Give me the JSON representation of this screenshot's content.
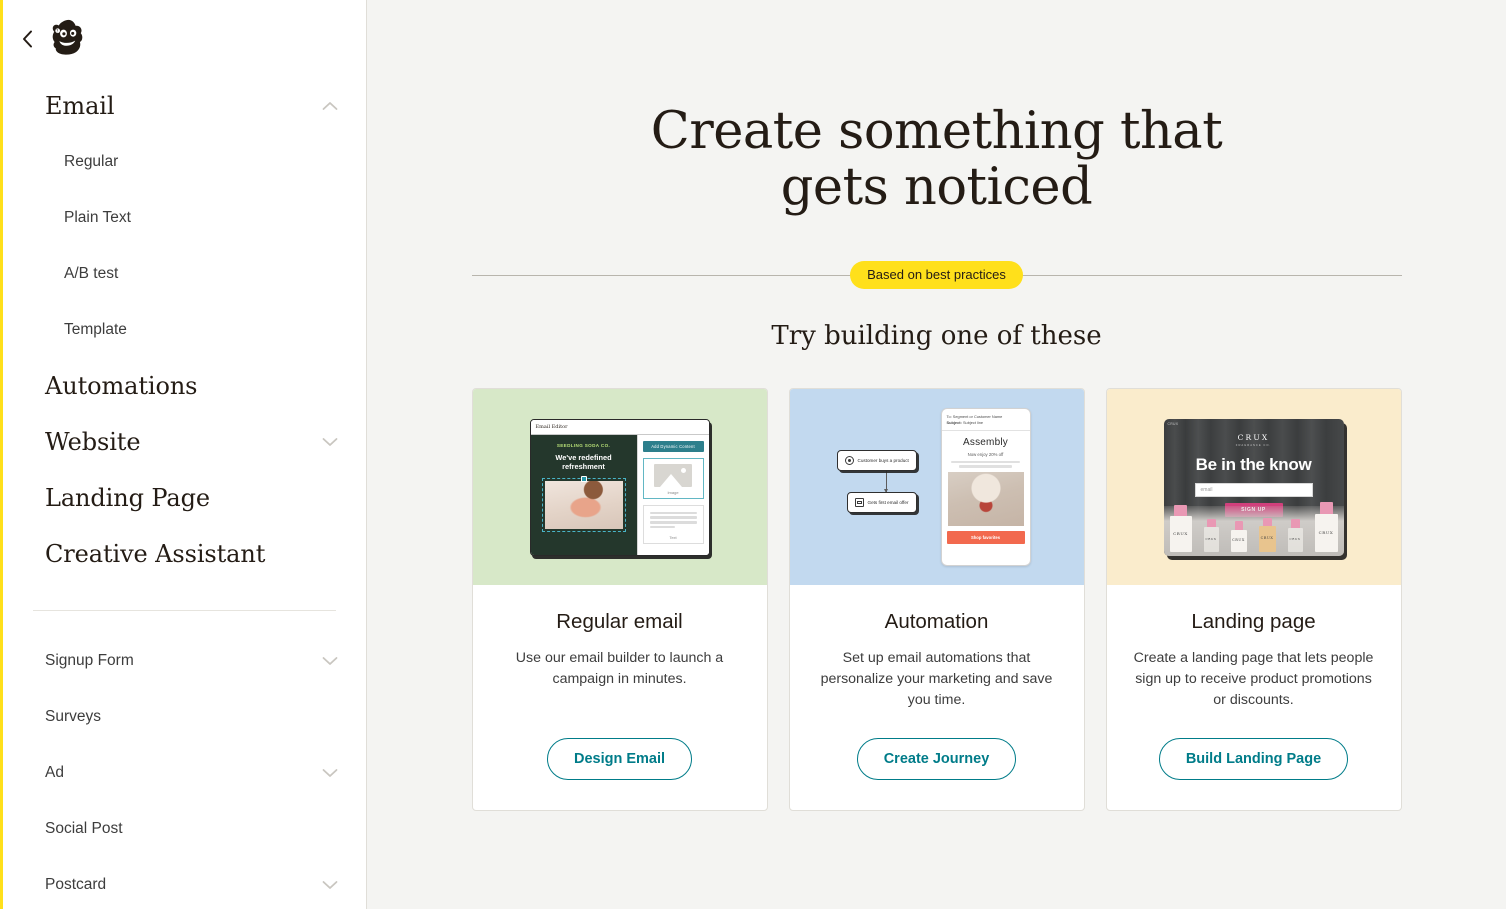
{
  "sidebar": {
    "collapse_icon": "chevron-left-icon",
    "logo": "mailchimp-freddie-logo",
    "primary_items": [
      {
        "label": "Email",
        "chevron": "chevron-up-icon",
        "expanded": true
      },
      {
        "label": "Automations",
        "chevron": null,
        "expanded": false
      },
      {
        "label": "Website",
        "chevron": "chevron-down-icon",
        "expanded": false
      },
      {
        "label": "Landing Page",
        "chevron": null,
        "expanded": false
      },
      {
        "label": "Creative Assistant",
        "chevron": null,
        "expanded": false
      }
    ],
    "email_children": [
      {
        "label": "Regular"
      },
      {
        "label": "Plain Text"
      },
      {
        "label": "A/B test"
      },
      {
        "label": "Template"
      }
    ],
    "secondary_items": [
      {
        "label": "Signup Form",
        "chevron": "chevron-down-icon"
      },
      {
        "label": "Surveys",
        "chevron": null
      },
      {
        "label": "Ad",
        "chevron": "chevron-down-icon"
      },
      {
        "label": "Social Post",
        "chevron": null
      },
      {
        "label": "Postcard",
        "chevron": "chevron-down-icon"
      }
    ]
  },
  "main": {
    "hero_title_line1": "Create something that",
    "hero_title_line2": "gets noticed",
    "badge": "Based on best practices",
    "subtitle": "Try building one of these"
  },
  "cards": [
    {
      "title": "Regular email",
      "description": "Use our email builder to launch a campaign in minutes.",
      "button": "Design Email",
      "hero_color": "#d7e8c8",
      "thumbnail": {
        "kind": "email-editor",
        "titlebar": "Email Editor",
        "brand": "SEEDLING SODA CO.",
        "headline": "We've redefined refreshment",
        "panel_button": "Add Dynamic Content",
        "block_image_label": "Image",
        "block_text_label": "Text"
      }
    },
    {
      "title": "Automation",
      "description": "Set up email automations that personalize your marketing and save you time.",
      "button": "Create Journey",
      "hero_color": "#c2d9ef",
      "thumbnail": {
        "kind": "automation-journey",
        "to_line": "To: Segment or Customer Name",
        "subject_label": "Subject:",
        "subject_value": "Subject line",
        "email_title": "Assembly",
        "email_offer": "Now enjoy 20% off",
        "email_cta": "Shop favorites",
        "node_1": "Customer buys a product",
        "node_1_icon": "trigger-icon",
        "node_2": "Gets first email offer",
        "node_2_icon": "envelope-icon"
      }
    },
    {
      "title": "Landing page",
      "description": "Create a landing page that lets people sign up to receive product promotions or discounts.",
      "button": "Build Landing Page",
      "hero_color": "#faeccc",
      "thumbnail": {
        "kind": "landing-page",
        "tag": "CRUX",
        "brand": "CRUX",
        "brand_sub": "FRAGRANCE CO.",
        "headline": "Be in the know",
        "input_placeholder": "email",
        "signup_button": "SIGN UP",
        "bottle_label": "CRUX"
      }
    }
  ],
  "colors": {
    "brand_yellow": "#ffe01b",
    "teal": "#007c89",
    "page_bg": "#f4f4f2",
    "sidebar_bg": "#ffffff",
    "text": "#241c15",
    "cta_orange": "#f2694e",
    "signup_pink": "#d1407c"
  }
}
